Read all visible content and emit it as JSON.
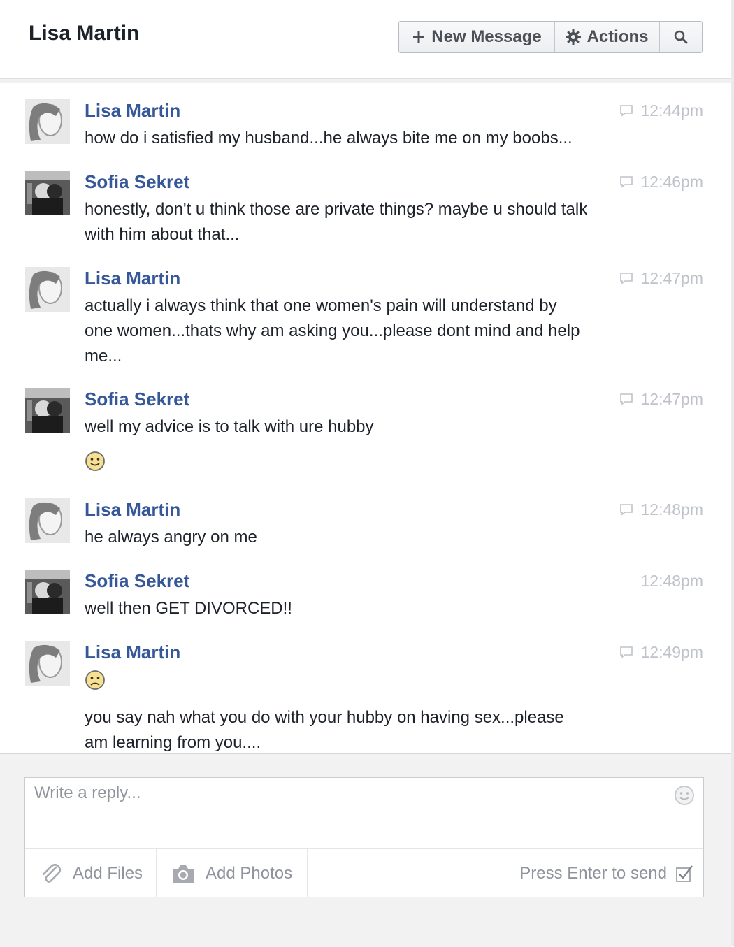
{
  "header": {
    "title": "Lisa Martin",
    "new_message_label": "New Message",
    "actions_label": "Actions"
  },
  "messages": [
    {
      "sender": "Lisa Martin",
      "time": "12:44pm",
      "seen_icon": true,
      "avatar": "lisa",
      "lines": [
        "how do i satisfied my husband...he always bite me on my boobs..."
      ]
    },
    {
      "sender": "Sofia Sekret",
      "time": "12:46pm",
      "seen_icon": true,
      "avatar": "sofia",
      "lines": [
        "honestly, don't u think those are private things? maybe u should talk",
        "with him about that..."
      ]
    },
    {
      "sender": "Lisa Martin",
      "time": "12:47pm",
      "seen_icon": true,
      "avatar": "lisa",
      "lines": [
        "actually i always think that one women's pain will understand by",
        "one women...thats why am asking you...please dont mind and help",
        "me..."
      ]
    },
    {
      "sender": "Sofia Sekret",
      "time": "12:47pm",
      "seen_icon": true,
      "avatar": "sofia",
      "lines": [
        "well my advice is to talk with ure hubby"
      ],
      "emoji_after": "smile"
    },
    {
      "sender": "Lisa Martin",
      "time": "12:48pm",
      "seen_icon": true,
      "avatar": "lisa",
      "lines": [
        "he always angry on me"
      ]
    },
    {
      "sender": "Sofia Sekret",
      "time": "12:48pm",
      "seen_icon": false,
      "avatar": "sofia",
      "lines": [
        "well then GET DIVORCED!!"
      ]
    },
    {
      "sender": "Lisa Martin",
      "time": "12:49pm",
      "seen_icon": true,
      "avatar": "lisa",
      "emoji_before": "frown",
      "lines": [
        "you say nah what you do with your hubby on having sex...please",
        "am learning from you...."
      ]
    }
  ],
  "composer": {
    "placeholder": "Write a reply...",
    "add_files_label": "Add Files",
    "add_photos_label": "Add Photos",
    "enter_to_send_label": "Press Enter to send",
    "enter_to_send_checked": true
  },
  "colors": {
    "sender_name": "#365899",
    "timestamp": "#bec2c9",
    "body_text": "#1d2129"
  }
}
